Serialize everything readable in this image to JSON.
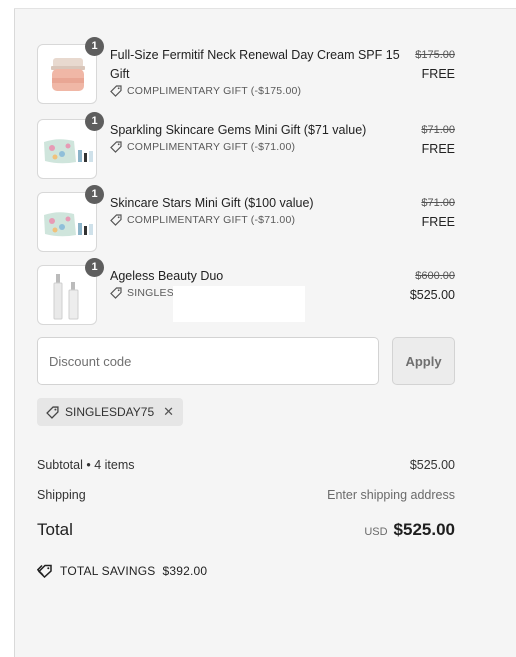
{
  "items": [
    {
      "name": "Full-Size Fermitif Neck Renewal Day Cream SPF 15 Gift",
      "quantity": "1",
      "tag": "COMPLIMENTARY GIFT (-$175.00)",
      "original_price": "$175.00",
      "price": "FREE",
      "image": "cream-jar"
    },
    {
      "name": "Sparkling Skincare Gems Mini Gift ($71 value)",
      "quantity": "1",
      "tag": "COMPLIMENTARY GIFT (-$71.00)",
      "original_price": "$71.00",
      "price": "FREE",
      "image": "cosmetic-pouch"
    },
    {
      "name": "Skincare Stars Mini Gift ($100 value)",
      "quantity": "1",
      "tag": "COMPLIMENTARY GIFT (-$71.00)",
      "original_price": "$71.00",
      "price": "FREE",
      "image": "cosmetic-pouch"
    },
    {
      "name": "Ageless Beauty Duo",
      "quantity": "1",
      "tag": "SINGLESDAY75 (-$75.00)",
      "original_price": "$600.00",
      "price": "$525.00",
      "image": "serum-bottles"
    }
  ],
  "discount": {
    "placeholder": "Discount code",
    "apply_label": "Apply"
  },
  "applied_code": {
    "label": "SINGLESDAY75",
    "remove_symbol": "✕"
  },
  "summary": {
    "subtotal_label": "Subtotal • 4 items",
    "subtotal_value": "$525.00",
    "shipping_label": "Shipping",
    "shipping_value": "Enter shipping address",
    "total_label": "Total",
    "currency": "USD",
    "total_value": "$525.00"
  },
  "savings": {
    "label": "TOTAL SAVINGS",
    "value": "$392.00"
  }
}
